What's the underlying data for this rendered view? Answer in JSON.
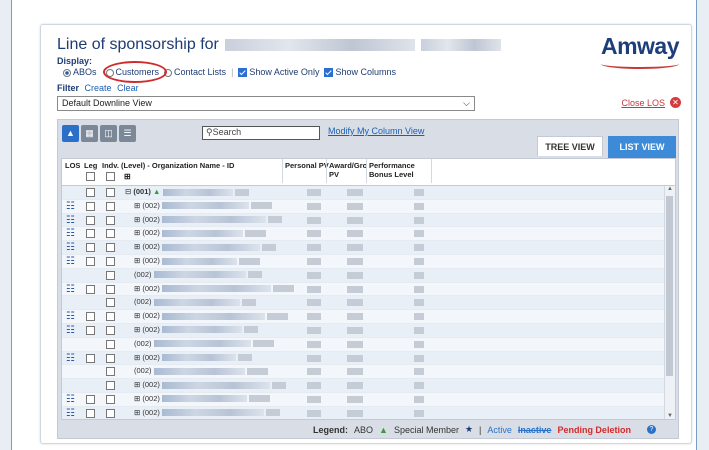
{
  "header": {
    "title": "Line of sponsorship for",
    "logo_text": "Amway"
  },
  "display": {
    "label": "Display:",
    "options": [
      "ABOs",
      "Customers",
      "Contact Lists"
    ],
    "selected": "ABOs",
    "show_active_only": "Show Active Only",
    "show_columns": "Show Columns"
  },
  "filter": {
    "label": "Filter",
    "create": "Create",
    "clear": "Clear"
  },
  "view_select": {
    "value": "Default Downline View"
  },
  "close_los": "Close LOS",
  "toolbar": {
    "search_placeholder": "Search",
    "modify_link": "Modify My Column View"
  },
  "tabs": {
    "tree": "TREE VIEW",
    "list": "LIST VIEW"
  },
  "grid": {
    "headers": {
      "los": "LOS",
      "leg": "Leg",
      "indv": "Indv. (Level) - Organization Name - ID",
      "personal_pv": "Personal PV",
      "award": "Award/Gro PV",
      "performance": "Performance Bonus Level"
    },
    "rows": [
      {
        "level": "(001)",
        "los": false,
        "leg": true,
        "indv": true,
        "expand": "⊟",
        "indent": 0,
        "bold": true
      },
      {
        "level": "(002)",
        "los": true,
        "leg": true,
        "indv": true,
        "expand": "⊞",
        "indent": 1
      },
      {
        "level": "(002)",
        "los": true,
        "leg": true,
        "indv": true,
        "expand": "⊞",
        "indent": 1
      },
      {
        "level": "(002)",
        "los": true,
        "leg": true,
        "indv": true,
        "expand": "⊞",
        "indent": 1
      },
      {
        "level": "(002)",
        "los": true,
        "leg": true,
        "indv": true,
        "expand": "⊞",
        "indent": 1
      },
      {
        "level": "(002)",
        "los": true,
        "leg": true,
        "indv": true,
        "expand": "⊞",
        "indent": 1
      },
      {
        "level": "(002)",
        "los": false,
        "leg": false,
        "indv": true,
        "expand": "",
        "indent": 1
      },
      {
        "level": "(002)",
        "los": true,
        "leg": true,
        "indv": true,
        "expand": "⊞",
        "indent": 1
      },
      {
        "level": "(002)",
        "los": false,
        "leg": false,
        "indv": true,
        "expand": "",
        "indent": 1
      },
      {
        "level": "(002)",
        "los": true,
        "leg": true,
        "indv": true,
        "expand": "⊞",
        "indent": 1
      },
      {
        "level": "(002)",
        "los": true,
        "leg": true,
        "indv": true,
        "expand": "⊞",
        "indent": 1
      },
      {
        "level": "(002)",
        "los": false,
        "leg": false,
        "indv": true,
        "expand": "",
        "indent": 1
      },
      {
        "level": "(002)",
        "los": true,
        "leg": true,
        "indv": true,
        "expand": "⊞",
        "indent": 1
      },
      {
        "level": "(002)",
        "los": false,
        "leg": false,
        "indv": true,
        "expand": "",
        "indent": 1
      },
      {
        "level": "(002)",
        "los": false,
        "leg": false,
        "indv": true,
        "expand": "⊞",
        "indent": 1
      },
      {
        "level": "(002)",
        "los": true,
        "leg": true,
        "indv": true,
        "expand": "⊞",
        "indent": 1
      },
      {
        "level": "(002)",
        "los": true,
        "leg": true,
        "indv": true,
        "expand": "⊞",
        "indent": 1
      },
      {
        "level": "(002)",
        "los": false,
        "leg": false,
        "indv": true,
        "expand": "",
        "indent": 1
      }
    ]
  },
  "legend": {
    "label": "Legend:",
    "abo": "ABO",
    "special": "Special Member",
    "separator": "|",
    "active": "Active",
    "inactive": "Inactive",
    "pending": "Pending Deletion"
  },
  "colors": {
    "brand": "#1d3e7a",
    "accent": "#3d8bd8",
    "pending": "#d12b2b"
  }
}
